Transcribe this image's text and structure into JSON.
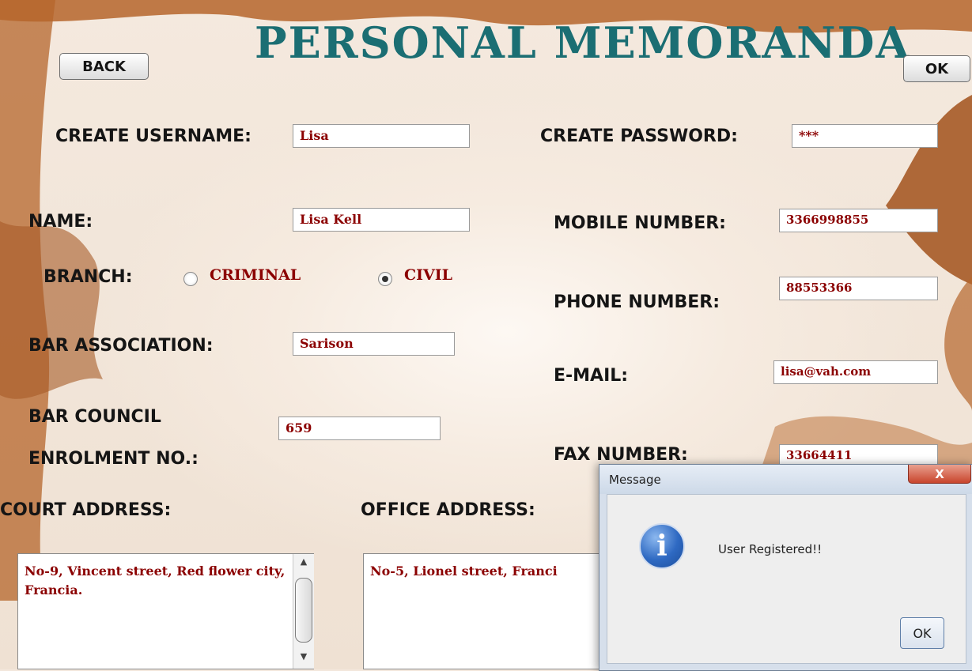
{
  "header": {
    "title": "PERSONAL MEMORANDA",
    "back_label": "BACK",
    "ok_label": "OK"
  },
  "form": {
    "username": {
      "label": "CREATE USERNAME:",
      "value": "Lisa"
    },
    "password": {
      "label": "CREATE PASSWORD:",
      "value": "***"
    },
    "name": {
      "label": "NAME:",
      "value": "Lisa Kell"
    },
    "mobile": {
      "label": "MOBILE NUMBER:",
      "value": "3366998855"
    },
    "branch": {
      "label": "BRANCH:",
      "options": [
        "CRIMINAL",
        "CIVIL"
      ],
      "selected": "CIVIL"
    },
    "phone": {
      "label": "PHONE NUMBER:",
      "value": "88553366"
    },
    "bar_association": {
      "label": "BAR ASSOCIATION:",
      "value": "Sarison"
    },
    "email": {
      "label": "E-MAIL:",
      "value": "lisa@vah.com"
    },
    "bar_council": {
      "label_line1": "BAR COUNCIL",
      "label_line2": "ENROLMENT NO.:",
      "value": "659"
    },
    "fax": {
      "label": "FAX NUMBER:",
      "value": "33664411"
    },
    "court_address": {
      "label": "COURT ADDRESS:",
      "value": "No-9, Vincent street, Red flower city, Francia."
    },
    "office_address": {
      "label": "OFFICE ADDRESS:",
      "value": "No-5, Lionel street, Franci"
    }
  },
  "dialog": {
    "title": "Message",
    "close_glyph": "X",
    "icon_glyph": "i",
    "message": "User Registered!!",
    "ok_label": "OK"
  },
  "colors": {
    "title": "#1b6e73",
    "field_text": "#8b0000",
    "brush": "#b5652b"
  }
}
